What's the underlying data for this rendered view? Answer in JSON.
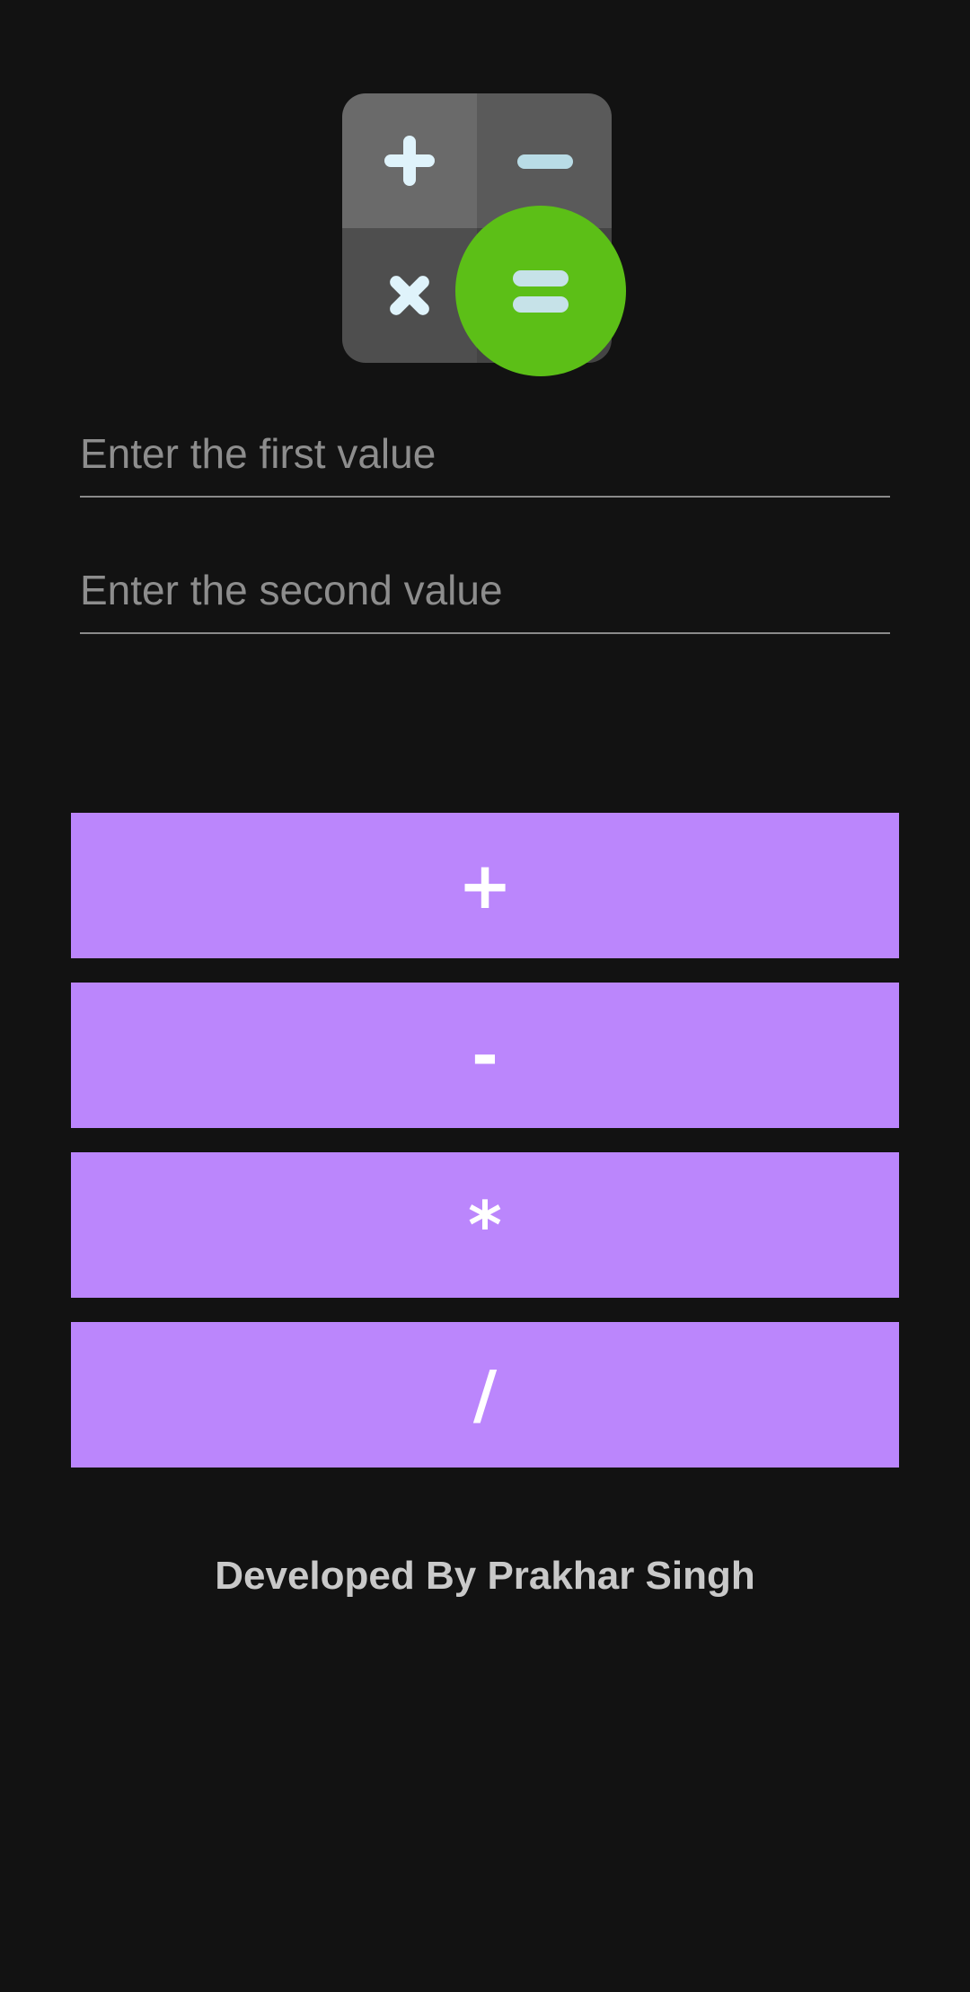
{
  "app": {
    "logo_icon": "calculator-icon",
    "accent_color": "#bb86fc",
    "background_color": "#121212",
    "logo_equals_color": "#5cbf17"
  },
  "inputs": {
    "first": {
      "placeholder": "Enter the first value",
      "value": ""
    },
    "second": {
      "placeholder": "Enter the second value",
      "value": ""
    }
  },
  "buttons": {
    "add": "+",
    "subtract": "-",
    "multiply": "*",
    "divide": "/"
  },
  "footer": {
    "credit": "Developed By Prakhar Singh"
  }
}
